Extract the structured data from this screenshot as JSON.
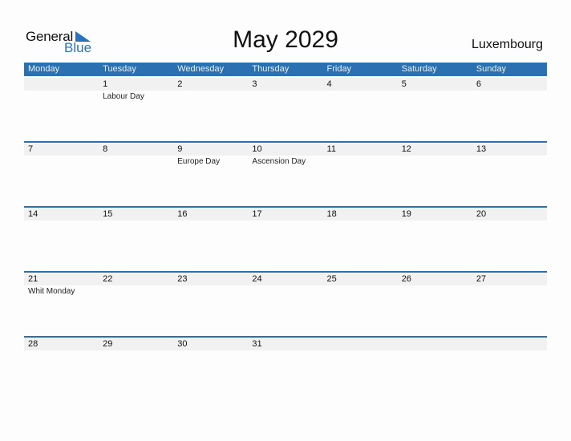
{
  "logo": {
    "word1": "General",
    "word2": "Blue"
  },
  "title": "May 2029",
  "country": "Luxembourg",
  "colors": {
    "accent": "#2b71b1",
    "strip": "#f1f1f1"
  },
  "weekdays": [
    "Monday",
    "Tuesday",
    "Wednesday",
    "Thursday",
    "Friday",
    "Saturday",
    "Sunday"
  ],
  "weeks": [
    [
      {
        "day": "",
        "holiday": ""
      },
      {
        "day": "1",
        "holiday": "Labour Day"
      },
      {
        "day": "2",
        "holiday": ""
      },
      {
        "day": "3",
        "holiday": ""
      },
      {
        "day": "4",
        "holiday": ""
      },
      {
        "day": "5",
        "holiday": ""
      },
      {
        "day": "6",
        "holiday": ""
      }
    ],
    [
      {
        "day": "7",
        "holiday": ""
      },
      {
        "day": "8",
        "holiday": ""
      },
      {
        "day": "9",
        "holiday": "Europe Day"
      },
      {
        "day": "10",
        "holiday": "Ascension Day"
      },
      {
        "day": "11",
        "holiday": ""
      },
      {
        "day": "12",
        "holiday": ""
      },
      {
        "day": "13",
        "holiday": ""
      }
    ],
    [
      {
        "day": "14",
        "holiday": ""
      },
      {
        "day": "15",
        "holiday": ""
      },
      {
        "day": "16",
        "holiday": ""
      },
      {
        "day": "17",
        "holiday": ""
      },
      {
        "day": "18",
        "holiday": ""
      },
      {
        "day": "19",
        "holiday": ""
      },
      {
        "day": "20",
        "holiday": ""
      }
    ],
    [
      {
        "day": "21",
        "holiday": "Whit Monday"
      },
      {
        "day": "22",
        "holiday": ""
      },
      {
        "day": "23",
        "holiday": ""
      },
      {
        "day": "24",
        "holiday": ""
      },
      {
        "day": "25",
        "holiday": ""
      },
      {
        "day": "26",
        "holiday": ""
      },
      {
        "day": "27",
        "holiday": ""
      }
    ],
    [
      {
        "day": "28",
        "holiday": ""
      },
      {
        "day": "29",
        "holiday": ""
      },
      {
        "day": "30",
        "holiday": ""
      },
      {
        "day": "31",
        "holiday": ""
      },
      {
        "day": "",
        "holiday": ""
      },
      {
        "day": "",
        "holiday": ""
      },
      {
        "day": "",
        "holiday": ""
      }
    ]
  ]
}
